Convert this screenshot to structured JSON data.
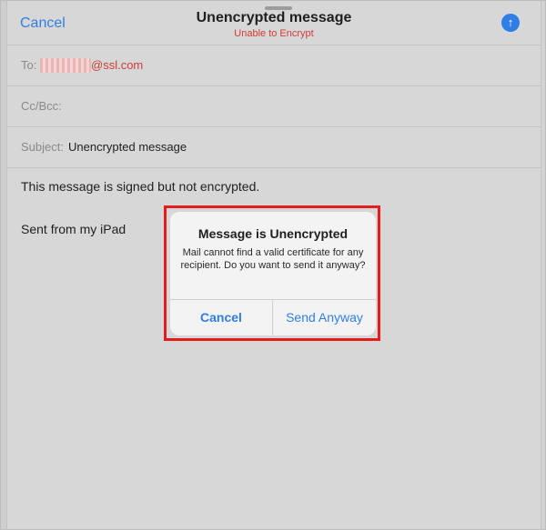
{
  "nav": {
    "cancel_label": "Cancel",
    "title": "Unencrypted message",
    "subtitle": "Unable to Encrypt",
    "send_icon": "arrow-up-icon",
    "send_glyph": "↑"
  },
  "fields": {
    "to_label": "To:",
    "to_domain": "@ssl.com",
    "cc_label": "Cc/Bcc:",
    "subject_label": "Subject:",
    "subject_value": "Unencrypted message"
  },
  "body": {
    "line1": "This message is signed but not encrypted.",
    "line2": "Sent from my iPad"
  },
  "alert": {
    "title": "Message is Unencrypted",
    "message": "Mail cannot find a valid certificate for any recipient. Do you want to send it anyway?",
    "cancel_label": "Cancel",
    "send_label": "Send Anyway"
  },
  "colors": {
    "accent": "#2f7ee6",
    "warning": "#d23b36",
    "highlight": "#e51c1c"
  }
}
